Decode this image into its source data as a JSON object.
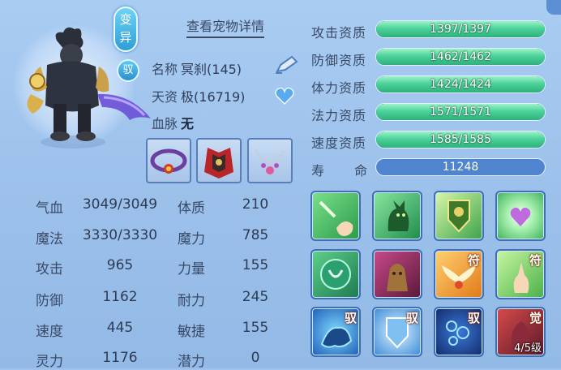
{
  "pet": {
    "badge_top": "变",
    "badge_bottom": "异",
    "badge_small": "驭",
    "detail_link": "查看宠物详情",
    "name_label": "名称",
    "name_value": "冥刹(145)",
    "talent_label": "天资",
    "talent_value": "极(16719)",
    "bloodline_label": "血脉",
    "bloodline_value": "无"
  },
  "stats": [
    {
      "label": "气血",
      "value": "3049/3049",
      "label2": "体质",
      "value2": "210"
    },
    {
      "label": "魔法",
      "value": "3330/3330",
      "label2": "魔力",
      "value2": "785"
    },
    {
      "label": "攻击",
      "value": "965",
      "label2": "力量",
      "value2": "155"
    },
    {
      "label": "防御",
      "value": "1162",
      "label2": "耐力",
      "value2": "245"
    },
    {
      "label": "速度",
      "value": "445",
      "label2": "敏捷",
      "value2": "155"
    },
    {
      "label": "灵力",
      "value": "1176",
      "label2": "潜力",
      "value2": "0"
    }
  ],
  "aptitudes": [
    {
      "label": "攻击资质",
      "value": "1397/1397",
      "fill": 1.0
    },
    {
      "label": "防御资质",
      "value": "1462/1462",
      "fill": 1.0
    },
    {
      "label": "体力资质",
      "value": "1424/1424",
      "fill": 1.0
    },
    {
      "label": "法力资质",
      "value": "1571/1571",
      "fill": 1.0
    },
    {
      "label": "速度资质",
      "value": "1585/1585",
      "fill": 1.0
    }
  ],
  "life": {
    "label_a": "寿",
    "label_b": "命",
    "value": "11248"
  },
  "skills": {
    "tag_fu": "符",
    "tag_yu": "驭",
    "tag_jue": "觉",
    "awaken_level": "4/5级"
  },
  "colors": {
    "panel_bg": "#a9ccf2",
    "bar_fill": "#4cd39a",
    "bar_track": "#2f5d9a",
    "life_bar": "#4f84cf",
    "text": "#3a4a66"
  },
  "icons": [
    "edit-icon",
    "heart-icon",
    "close-icon"
  ]
}
